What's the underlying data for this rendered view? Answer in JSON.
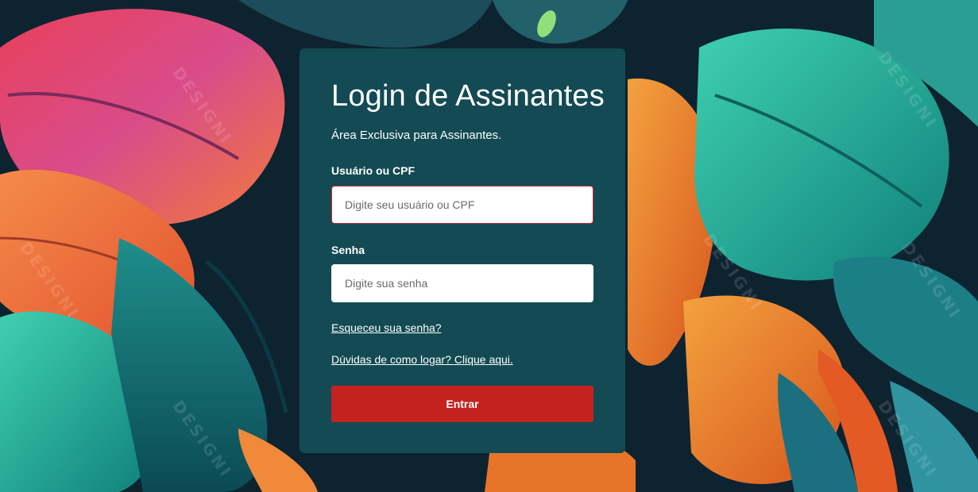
{
  "login": {
    "title": "Login de Assinantes",
    "subtitle": "Área Exclusiva para Assinantes.",
    "username_label": "Usuário ou CPF",
    "username_placeholder": "Digite seu usuário ou CPF",
    "username_value": "",
    "password_label": "Senha",
    "password_placeholder": "Digite sua senha",
    "password_value": "",
    "forgot_link": "Esqueceu sua senha?",
    "help_link": "Dúvidas de como logar? Clique aqui.",
    "submit_label": "Entrar"
  },
  "watermark": "DESIGNI",
  "colors": {
    "card_bg": "#134a53",
    "button_bg": "#c4221f",
    "input_focus_border": "#c8253a"
  }
}
